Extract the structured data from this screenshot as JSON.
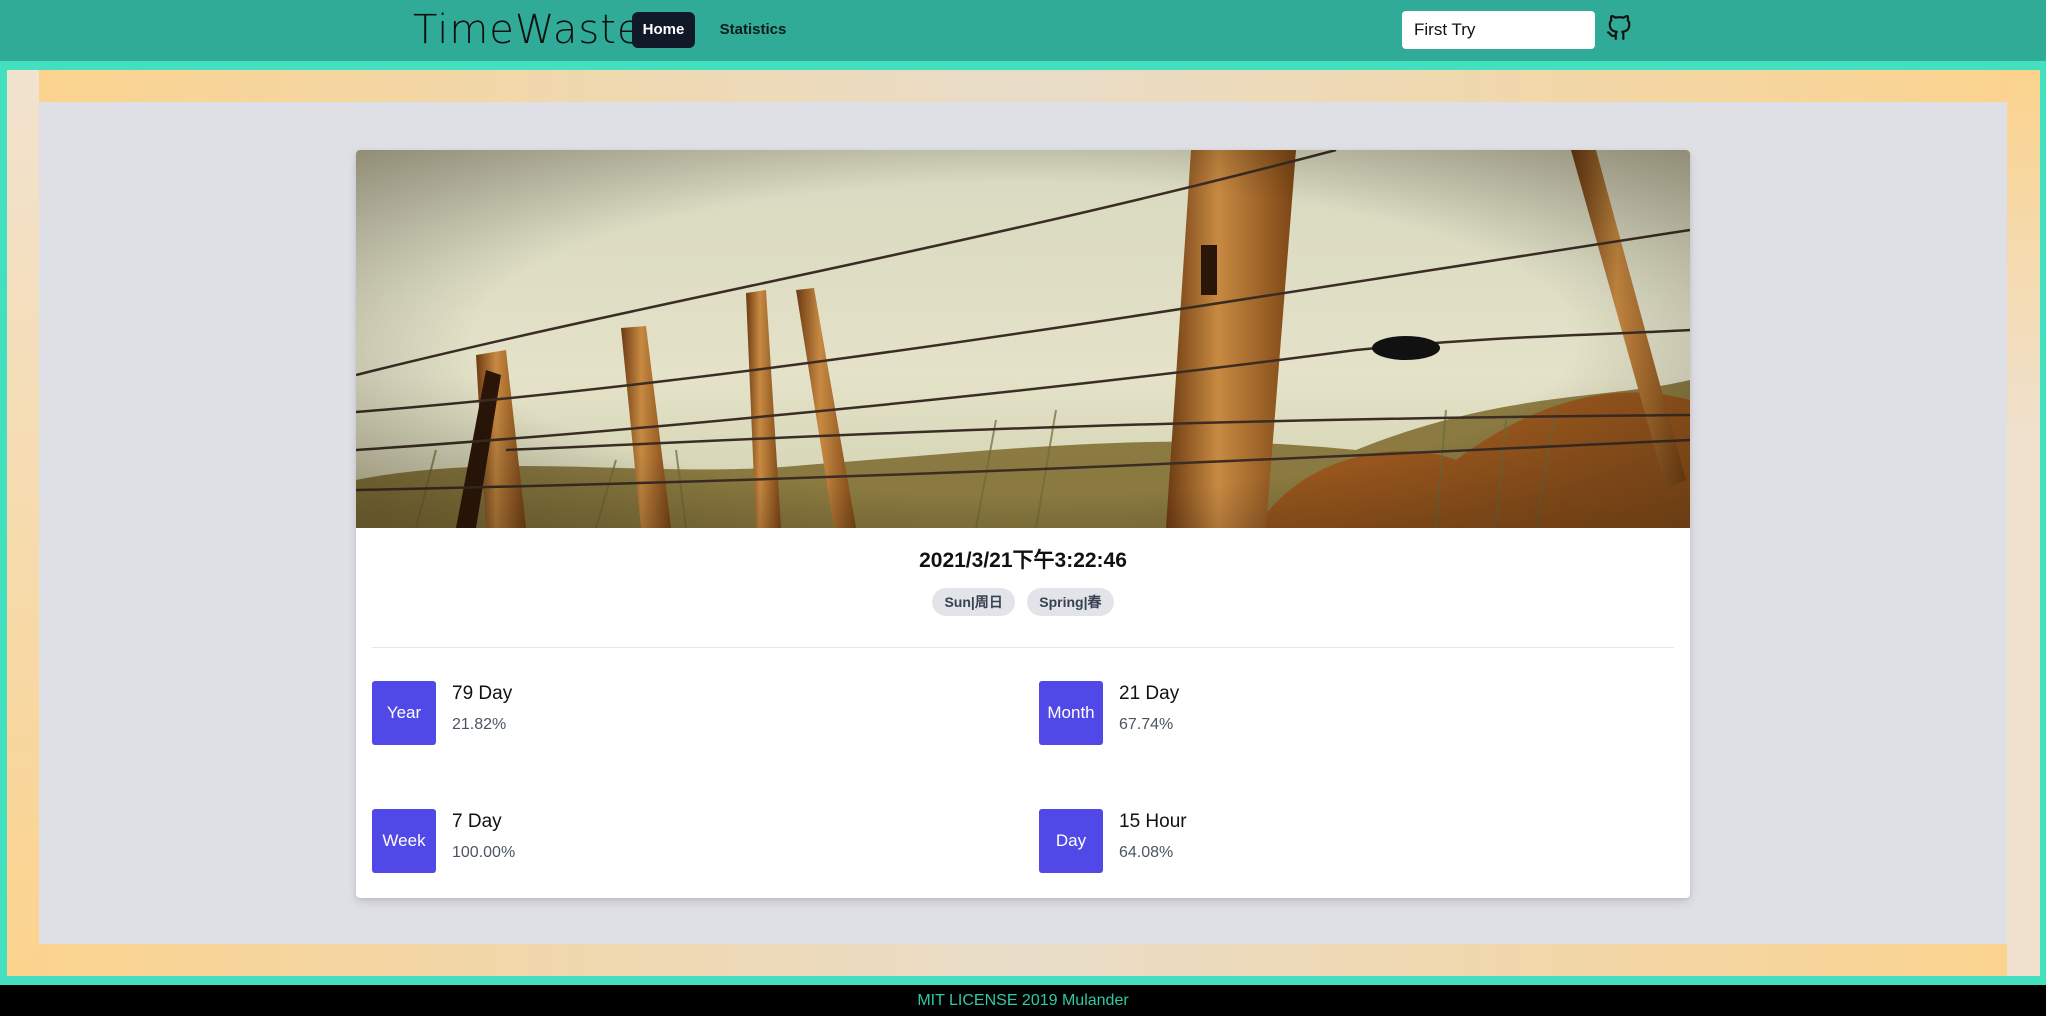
{
  "navbar": {
    "logo": "TimeWaster",
    "home_label": "Home",
    "statistics_label": "Statistics",
    "search_value": "First Try",
    "github_icon": "github-icon"
  },
  "card": {
    "hero_image": "barbed-wire fence posts in tall grass against pale sky",
    "datetime": "2021/3/21下午3:22:46",
    "tags": [
      "Sun|周日",
      "Spring|春"
    ],
    "stats": {
      "year": {
        "label": "Year",
        "value": "79 Day",
        "percent": "21.82%"
      },
      "month": {
        "label": "Month",
        "value": "21 Day",
        "percent": "67.74%"
      },
      "week": {
        "label": "Week",
        "value": "7 Day",
        "percent": "100.00%"
      },
      "day": {
        "label": "Day",
        "value": "15 Hour",
        "percent": "64.08%"
      }
    }
  },
  "footer": {
    "text": "MIT LICENSE 2019 Mulander"
  },
  "colors": {
    "navbar": "#30ab98",
    "accent_border": "#43e0c0",
    "frame_gradient": "#fbd38d",
    "page_bg": "#dfe0e5",
    "badge": "#5049e8",
    "home_button": "#111827",
    "footer_text": "#31c9a3"
  }
}
